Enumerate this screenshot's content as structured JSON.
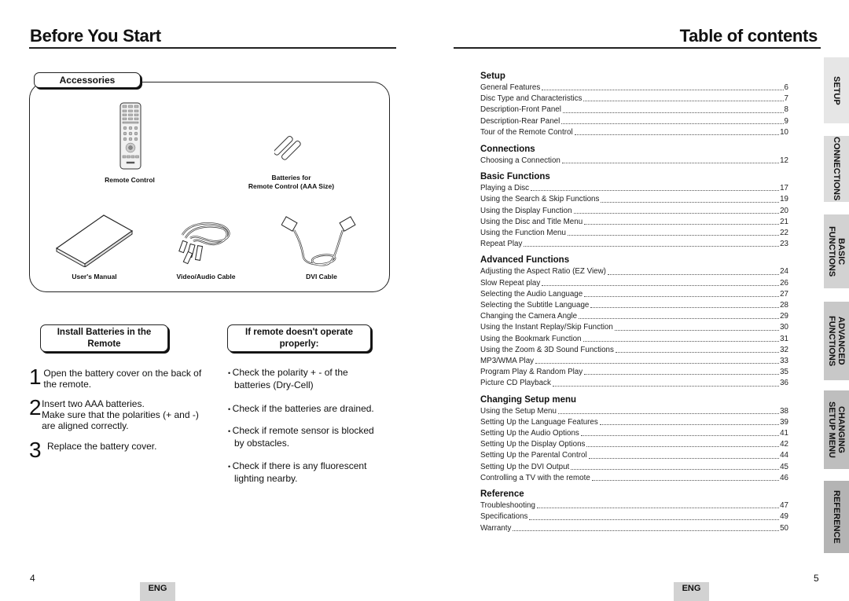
{
  "left_page": {
    "title": "Before You Start",
    "accessories": {
      "heading": "Accessories",
      "items": [
        {
          "label": "Remote Control",
          "icon": "remote-control-icon"
        },
        {
          "label_line1": "Batteries for",
          "label_line2": "Remote Control (AAA Size)",
          "icon": "batteries-icon"
        },
        {
          "label": "User's Manual",
          "icon": "user-manual-icon"
        },
        {
          "label": "Video/Audio Cable",
          "icon": "video-audio-cable-icon"
        },
        {
          "label": "DVI Cable",
          "icon": "dvi-cable-icon"
        }
      ]
    },
    "install": {
      "heading_line1": "Install Batteries in the",
      "heading_line2": "Remote",
      "steps": [
        {
          "num": "1",
          "text": "Open the battery cover on the back of the remote."
        },
        {
          "num": "2",
          "line1": "Insert two AAA batteries.",
          "line2": "Make sure that the polarities (+ and -) are aligned correctly."
        },
        {
          "num": "3",
          "text": "Replace the battery cover."
        }
      ]
    },
    "troubleshoot": {
      "heading_line1": "If remote doesn't operate",
      "heading_line2": "properly:",
      "bullets": [
        "Check the polarity + - of the batteries (Dry-Cell)",
        "Check if the batteries are drained.",
        "Check if remote sensor is blocked by obstacles.",
        "Check if there is any fluorescent lighting nearby."
      ]
    },
    "page_number": "4",
    "lang_badge": "ENG"
  },
  "right_page": {
    "title": "Table of contents",
    "sections": [
      {
        "heading": "Setup",
        "entries": [
          {
            "title": "General Features",
            "page": "6"
          },
          {
            "title": "Disc Type and Characteristics",
            "page": "7"
          },
          {
            "title": "Description-Front Panel",
            "page": "8"
          },
          {
            "title": "Description-Rear Panel",
            "page": "9"
          },
          {
            "title": "Tour of the Remote Control",
            "page": "10"
          }
        ]
      },
      {
        "heading": "Connections",
        "entries": [
          {
            "title": "Choosing a Connection",
            "page": "12"
          }
        ]
      },
      {
        "heading": "Basic Functions",
        "entries": [
          {
            "title": "Playing a Disc",
            "page": "17"
          },
          {
            "title": "Using the Search & Skip Functions",
            "page": "19"
          },
          {
            "title": "Using the Display Function",
            "page": "20"
          },
          {
            "title": "Using the Disc and Title Menu",
            "page": "21"
          },
          {
            "title": "Using the Function Menu",
            "page": "22"
          },
          {
            "title": "Repeat Play",
            "page": "23"
          }
        ]
      },
      {
        "heading": "Advanced Functions",
        "entries": [
          {
            "title": "Adjusting the Aspect Ratio (EZ View)",
            "page": "24"
          },
          {
            "title": "Slow Repeat play",
            "page": "26"
          },
          {
            "title": "Selecting the Audio Language",
            "page": "27"
          },
          {
            "title": "Selecting the Subtitle Language",
            "page": "28"
          },
          {
            "title": "Changing the Camera Angle",
            "page": "29"
          },
          {
            "title": "Using the Instant Replay/Skip Function",
            "page": "30"
          },
          {
            "title": "Using the Bookmark Function",
            "page": "31"
          },
          {
            "title": "Using the Zoom & 3D Sound Functions",
            "page": "32"
          },
          {
            "title": "MP3/WMA Play",
            "page": "33"
          },
          {
            "title": "Program Play & Random Play",
            "page": "35"
          },
          {
            "title": "Picture CD Playback",
            "page": "36"
          }
        ]
      },
      {
        "heading": "Changing Setup menu",
        "entries": [
          {
            "title": "Using the Setup Menu",
            "page": "38"
          },
          {
            "title": "Setting Up the Language Features",
            "page": "39"
          },
          {
            "title": "Setting Up the Audio Options",
            "page": "41"
          },
          {
            "title": "Setting Up the Display Options",
            "page": "42"
          },
          {
            "title": "Setting Up the Parental Control",
            "page": "44"
          },
          {
            "title": "Setting Up the DVI Output",
            "page": "45"
          },
          {
            "title": "Controlling a TV with the remote",
            "page": "46"
          }
        ]
      },
      {
        "heading": "Reference",
        "entries": [
          {
            "title": "Troubleshooting",
            "page": "47"
          },
          {
            "title": "Specifications",
            "page": "49"
          },
          {
            "title": "Warranty",
            "page": "50"
          }
        ]
      }
    ],
    "side_tabs": [
      {
        "label": "SETUP",
        "color": "#e6e6e6"
      },
      {
        "label": "CONNECTIONS",
        "color": "#dcdcdc"
      },
      {
        "label": "BASIC\nFUNCTIONS",
        "color": "#d2d2d2"
      },
      {
        "label": "ADVANCED\nFUNCTIONS",
        "color": "#c8c8c8"
      },
      {
        "label": "CHANGING\nSETUP MENU",
        "color": "#bebebe"
      },
      {
        "label": "REFERENCE",
        "color": "#b4b4b4"
      }
    ],
    "page_number": "5",
    "lang_badge": "ENG"
  }
}
